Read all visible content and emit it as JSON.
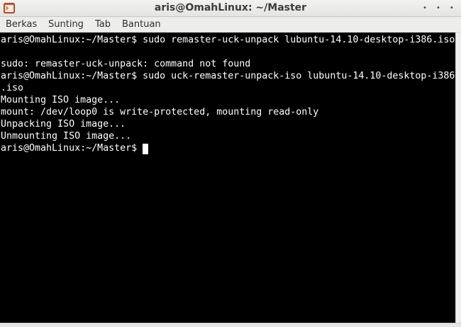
{
  "window": {
    "title": "aris@OmahLinux: ~/Master",
    "buttons": [
      "•",
      "•",
      "•"
    ]
  },
  "menubar": {
    "items": [
      "Berkas",
      "Sunting",
      "Tab",
      "Bantuan"
    ]
  },
  "terminal": {
    "lines": [
      "aris@OmahLinux:~/Master$ sudo remaster-uck-unpack lubuntu-14.10-desktop-i386.iso",
      "",
      "sudo: remaster-uck-unpack: command not found",
      "aris@OmahLinux:~/Master$ sudo uck-remaster-unpack-iso lubuntu-14.10-desktop-i386",
      ".iso",
      "Mounting ISO image...",
      "mount: /dev/loop0 is write-protected, mounting read-only",
      "Unpacking ISO image...",
      "Unmounting ISO image...",
      "aris@OmahLinux:~/Master$ "
    ]
  },
  "colors": {
    "background": "#000000",
    "text": "#ffffff",
    "chrome": "#ededeb",
    "app_icon": "#d9542b"
  }
}
